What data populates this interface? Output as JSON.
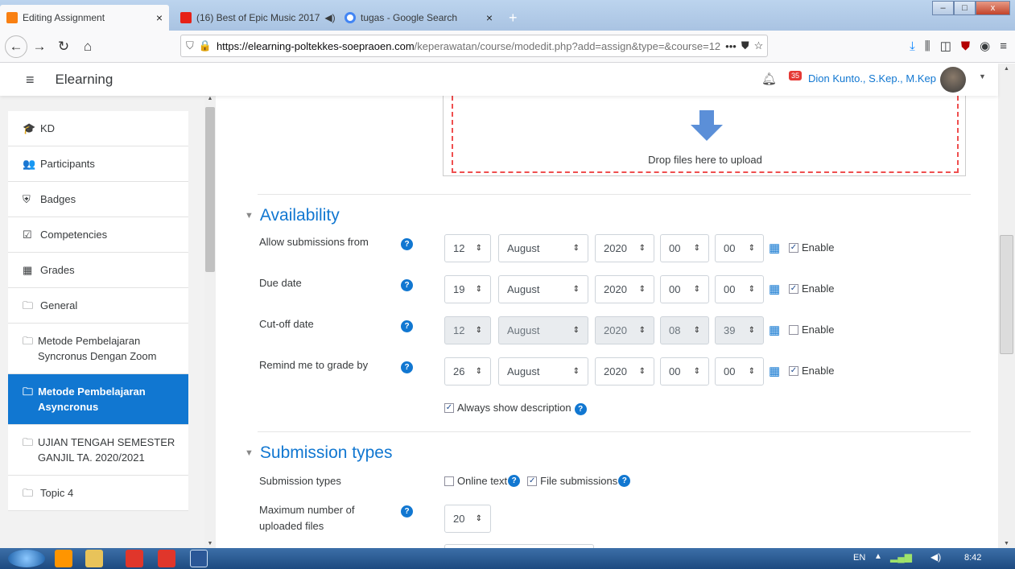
{
  "browser": {
    "tabs": [
      {
        "title": "Editing Assignment",
        "close": "×"
      },
      {
        "title": "(16) Best of Epic Music 2017",
        "audio": "◀)",
        "close": "×"
      },
      {
        "title": "tugas - Google Search",
        "close": "×"
      }
    ],
    "new_tab": "+",
    "url_domain": "https://elearning-poltekkes-soepraoen.com",
    "url_path": "/keperawatan/course/modedit.php?add=assign&type=&course=12",
    "window_controls": {
      "minimize": "–",
      "maximize": "□",
      "close": "x"
    }
  },
  "header": {
    "menu_icon": "≡",
    "title": "Elearning",
    "notif_count": "35",
    "user_name": "Dion Kunto., S.Kep., M.Kep"
  },
  "sidebar": {
    "items": [
      {
        "label": "KD",
        "icon": "graduation-cap-icon",
        "glyph": "🎓"
      },
      {
        "label": "Participants",
        "icon": "users-icon",
        "glyph": "👥"
      },
      {
        "label": "Badges",
        "icon": "shield-icon",
        "glyph": "⛨"
      },
      {
        "label": "Competencies",
        "icon": "checkbox-icon",
        "glyph": "☑"
      },
      {
        "label": "Grades",
        "icon": "table-icon",
        "glyph": "▦"
      },
      {
        "label": "General",
        "icon": "folder-icon",
        "glyph": "🗀"
      },
      {
        "label": "Metode Pembelajaran Syncronus Dengan Zoom",
        "icon": "folder-icon",
        "glyph": "🗀"
      },
      {
        "label": "Metode Pembelajaran Asyncronus",
        "icon": "folder-icon",
        "glyph": "🗀",
        "active": true
      },
      {
        "label": "UJIAN TENGAH SEMESTER GANJIL TA. 2020/2021",
        "icon": "folder-icon",
        "glyph": "🗀"
      },
      {
        "label": "Topic 4",
        "icon": "folder-icon",
        "glyph": "🗀"
      }
    ]
  },
  "upload": {
    "drop_text": "Drop files here to upload"
  },
  "availability": {
    "title": "Availability",
    "rows": [
      {
        "label": "Allow submissions from",
        "day": "12",
        "month": "August",
        "year": "2020",
        "hour": "00",
        "minute": "00",
        "enable": "Enable",
        "checked": true,
        "disabled": false
      },
      {
        "label": "Due date",
        "day": "19",
        "month": "August",
        "year": "2020",
        "hour": "00",
        "minute": "00",
        "enable": "Enable",
        "checked": true,
        "disabled": false
      },
      {
        "label": "Cut-off date",
        "day": "12",
        "month": "August",
        "year": "2020",
        "hour": "08",
        "minute": "39",
        "enable": "Enable",
        "checked": false,
        "disabled": true
      },
      {
        "label": "Remind me to grade by",
        "day": "26",
        "month": "August",
        "year": "2020",
        "hour": "00",
        "minute": "00",
        "enable": "Enable",
        "checked": true,
        "disabled": false
      }
    ],
    "always_show": "Always show description"
  },
  "submission": {
    "title": "Submission types",
    "types_label": "Submission types",
    "online_text": "Online text",
    "file_submissions": "File submissions",
    "max_files_label": "Maximum number of uploaded files",
    "max_files_value": "20"
  },
  "taskbar": {
    "lang": "EN",
    "time": "8:42"
  },
  "colors": {
    "accent": "#1177d1",
    "active_nav": "#1177d1",
    "dashed_border": "#ef4f4f"
  }
}
